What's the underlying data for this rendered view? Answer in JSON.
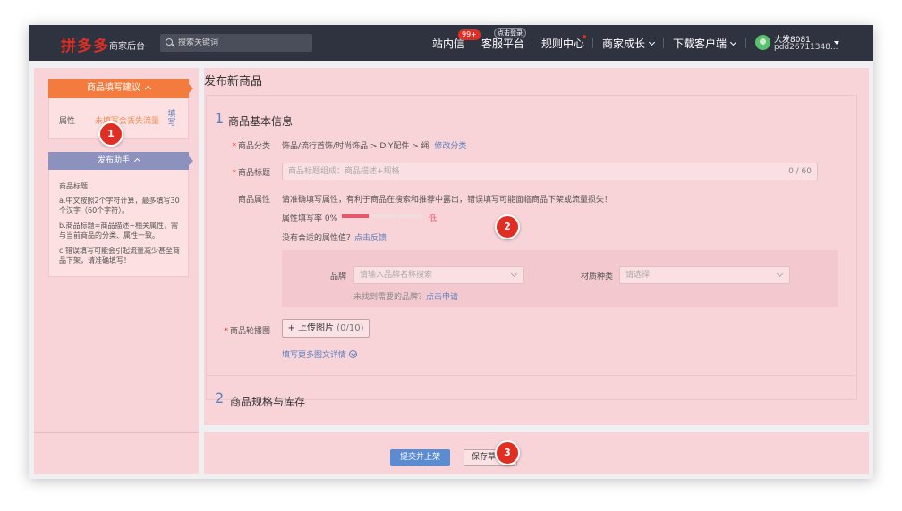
{
  "topbar": {
    "logo": "拼多多",
    "logo_sub": "商家后台",
    "search_placeholder": "搜索关键词",
    "nav": [
      {
        "label": "站内信",
        "badge": "99+"
      },
      {
        "label": "客服平台",
        "badge": "点击登录"
      },
      {
        "label": "规则中心"
      },
      {
        "label": "商家成长"
      },
      {
        "label": "下载客户端"
      }
    ],
    "user_name": "大发8081",
    "user_id": "pdd26711348..."
  },
  "sidebar": {
    "card1_title": "商品填写建议",
    "attr_label": "属性",
    "attr_warn": "未填写会丢失流量",
    "attr_fill": "填写",
    "card2_title": "发布助手",
    "help_title": "商品标题",
    "help_items": [
      "a.中文按照2个字符计算，最多填写30个汉字（60个字符）。",
      "b.商品标题=商品描述+相关属性，需与当前商品的分类、属性一致。",
      "c.错误填写可能会引起流量减少甚至商品下架，请准确填写！"
    ]
  },
  "main": {
    "page_title": "发布新商品",
    "section1": {
      "num": "1",
      "title": "商品基本信息"
    },
    "category": {
      "label": "商品分类",
      "value": "饰品/流行首饰/时尚饰品 > DIY配件 > 绳",
      "link": "修改分类"
    },
    "title_field": {
      "label": "商品标题",
      "placeholder": "商品标题组成：商品描述+规格",
      "counter": "0 / 60"
    },
    "attributes": {
      "label": "商品属性",
      "hint": "请准确填写属性，有利于商品在搜索和推荐中露出，错误填写可能面临商品下架或流量损失！",
      "rate_label": "属性填写率 0%",
      "rate_level": "低",
      "rate_percent": 0,
      "no_match": "没有合适的属性值？",
      "feedback_link": "点击反馈",
      "brand_label": "品牌",
      "brand_placeholder": "请输入品牌名称搜索",
      "brand_missing": "未找到需要的品牌？",
      "brand_apply_link": "点击申请",
      "material_label": "材质种类",
      "material_placeholder": "请选择"
    },
    "carousel": {
      "label": "商品轮播图",
      "button_plus": "+ 上传图片",
      "button_count": "(0/10)",
      "more_link": "填写更多图文详情"
    },
    "section2": {
      "num": "2",
      "title": "商品规格与库存"
    }
  },
  "footer": {
    "submit": "提交并上架",
    "save": "保存草稿"
  },
  "markers": [
    "1",
    "2",
    "3"
  ],
  "colors": {
    "accent_red": "#e02e24",
    "link_blue": "#5b7fbf",
    "highlight": "#f8d3d8",
    "orange": "#f47b3e",
    "purple": "#8c92bd"
  }
}
